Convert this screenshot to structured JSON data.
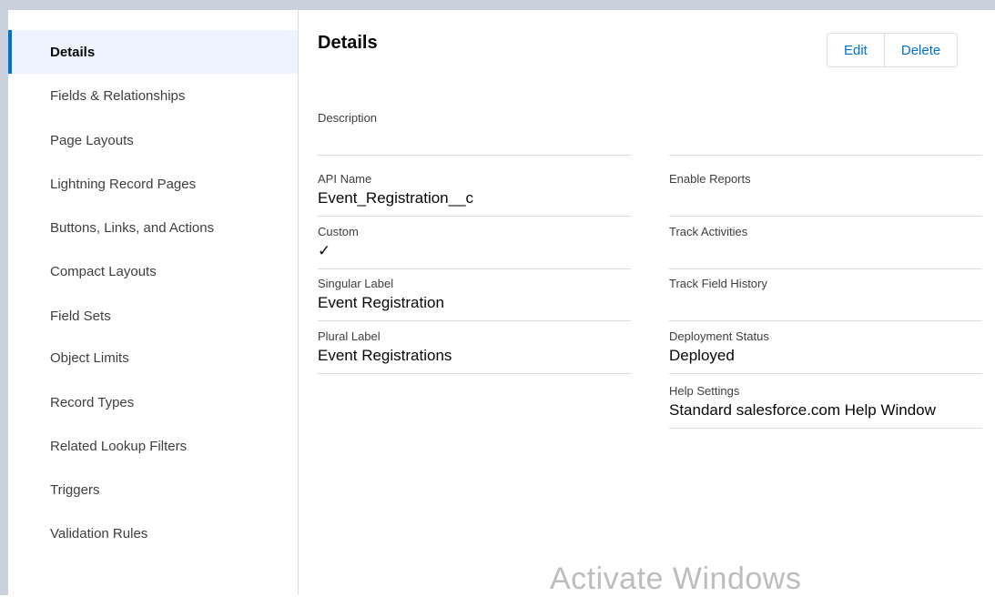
{
  "sidebar": {
    "items": [
      {
        "label": "Details",
        "active": true
      },
      {
        "label": "Fields & Relationships"
      },
      {
        "label": "Page Layouts"
      },
      {
        "label": "Lightning Record Pages"
      },
      {
        "label": "Buttons, Links, and Actions"
      },
      {
        "label": "Compact Layouts"
      },
      {
        "label": "Field Sets"
      },
      {
        "label": "Object Limits"
      },
      {
        "label": "Record Types"
      },
      {
        "label": "Related Lookup Filters"
      },
      {
        "label": "Triggers"
      },
      {
        "label": "Validation Rules"
      }
    ]
  },
  "main": {
    "title": "Details",
    "buttons": {
      "edit": "Edit",
      "delete": "Delete"
    },
    "fields_left": [
      {
        "label": "Description",
        "value": ""
      },
      {
        "label": "API Name",
        "value": "Event_Registration__c"
      },
      {
        "label": "Custom",
        "value": "✓",
        "icon": "checkmark-icon"
      },
      {
        "label": "Singular Label",
        "value": "Event Registration"
      },
      {
        "label": "Plural Label",
        "value": "Event Registrations"
      }
    ],
    "fields_right": [
      {
        "label": "",
        "value": ""
      },
      {
        "label": "Enable Reports",
        "value": ""
      },
      {
        "label": "Track Activities",
        "value": ""
      },
      {
        "label": "Track Field History",
        "value": ""
      },
      {
        "label": "Deployment Status",
        "value": "Deployed"
      },
      {
        "label": "Help Settings",
        "value": "Standard salesforce.com Help Window"
      }
    ]
  },
  "watermark": "Activate Windows",
  "colors": {
    "accent": "#0070d2",
    "active_bg": "#eef4ff",
    "border": "#dddbda"
  }
}
